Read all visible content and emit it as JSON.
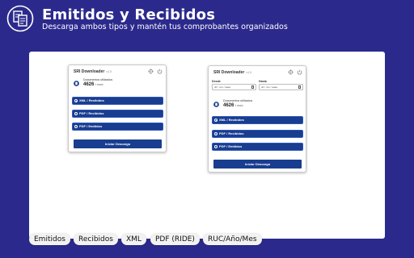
{
  "header": {
    "title": "Emitidos y Recibidos",
    "subtitle": "Descarga ambos tipos y mantén tus comprobantes organizados",
    "logo_icon": "document-transfer-icon"
  },
  "popup_small": {
    "app_name": "SRI Downloader",
    "version": "v1.0",
    "docs_label": "Documentos utilizados",
    "docs_count": "4626",
    "docs_max": "/ ∞∞∞",
    "options": [
      {
        "label": "XML / Recibidos",
        "selected": true
      },
      {
        "label": "PDF / Recibidos",
        "selected": false
      },
      {
        "label": "PDF / Emitidos",
        "selected": false
      }
    ],
    "action_label": "Iniciar Descarga"
  },
  "popup_large": {
    "app_name": "SRI Downloader",
    "version": "v1.0",
    "date_from_label": "Desde",
    "date_from_placeholder": "dd / mm / aaaa",
    "date_to_label": "Hasta",
    "date_to_placeholder": "dd / mm / aaaa",
    "docs_label": "Documentos utilizados",
    "docs_count": "4626",
    "docs_max": "/ ∞∞∞",
    "options": [
      {
        "label": "XML / Recibidos",
        "selected": true
      },
      {
        "label": "PDF / Recibidos",
        "selected": false
      },
      {
        "label": "PDF / Emitidos",
        "selected": false
      }
    ],
    "action_label": "Iniciar Descarga"
  },
  "tags": [
    "Emitidos",
    "Recibidos",
    "XML",
    "PDF (RIDE)",
    "RUC/Año/Mes"
  ],
  "colors": {
    "background": "#2b2a8c",
    "primary_button": "#193d8f",
    "stage": "#ffffff"
  }
}
